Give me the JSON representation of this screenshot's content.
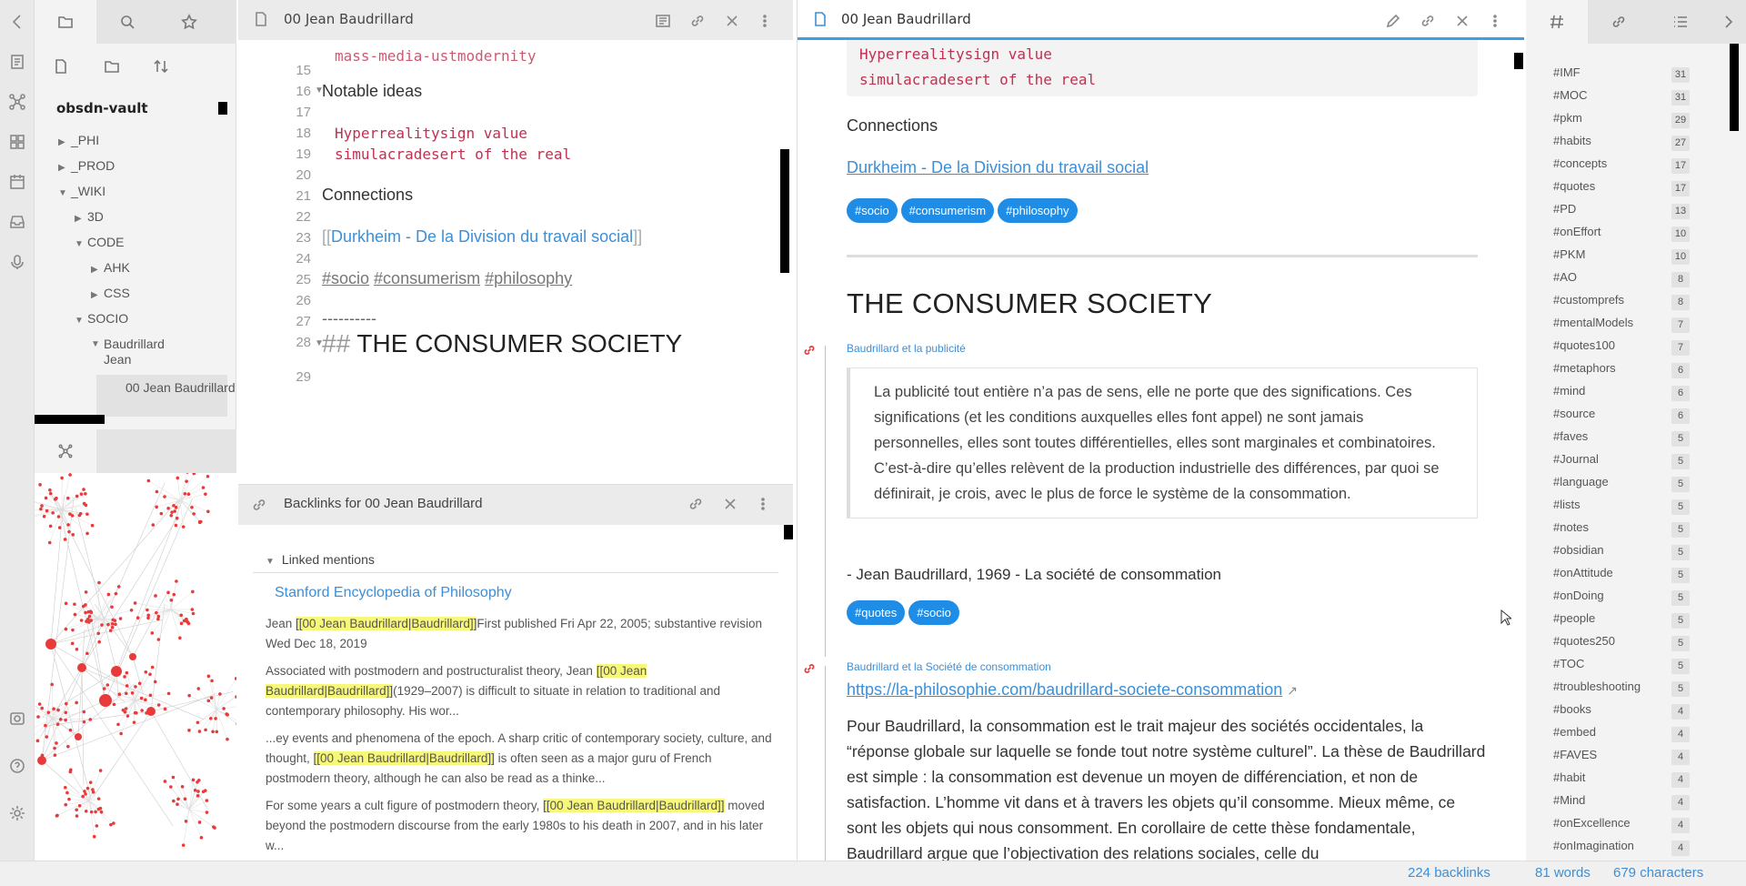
{
  "left_pane": {
    "vault_name": "obsdn-vault",
    "tree": [
      {
        "label": "_PHI",
        "level": 0,
        "state": "collapsed"
      },
      {
        "label": "_PROD",
        "level": 0,
        "state": "collapsed"
      },
      {
        "label": "_WIKI",
        "level": 0,
        "state": "expanded"
      },
      {
        "label": "3D",
        "level": 1,
        "state": "collapsed"
      },
      {
        "label": "CODE",
        "level": 1,
        "state": "expanded"
      },
      {
        "label": "AHK",
        "level": 2,
        "state": "collapsed"
      },
      {
        "label": "CSS",
        "level": 2,
        "state": "collapsed"
      },
      {
        "label": "SOCIO",
        "level": 1,
        "state": "expanded"
      },
      {
        "label": "Baudrillard Jean",
        "level": 2,
        "state": "expanded"
      }
    ],
    "selected_file": "00 Jean Baudrillard"
  },
  "editor_pane": {
    "title": "00 Jean Baudrillard",
    "partial_top_line": "mass-media-ustmodernity",
    "line_numbers": [
      "15",
      "16",
      "17",
      "18",
      "19",
      "20",
      "21",
      "22",
      "23",
      "24",
      "25",
      "26",
      "27",
      "28",
      "29"
    ],
    "notable_ideas": "Notable ideas",
    "code1": "Hyperrealitysign value",
    "code2": "simulacradesert of the real",
    "connections": "Connections",
    "link_open": "[[",
    "link_text": "Durkheim - De la Division du travail social",
    "link_close": "]]",
    "tags": [
      "#socio",
      "#consumerism",
      "#philosophy"
    ],
    "rule": "----------",
    "heading_marker": "## ",
    "heading_text": "THE CONSUMER SOCIETY"
  },
  "backlinks_pane": {
    "title": "Backlinks for 00 Jean Baudrillard",
    "linked_mentions": "Linked mentions",
    "source": "Stanford Encyclopedia of Philosophy",
    "snippets": [
      {
        "before": "Jean ",
        "highlight": "[[00 Jean Baudrillard|Baudrillard]]",
        "after": "First published Fri Apr 22, 2005; substantive revision Wed Dec 18, 2019"
      },
      {
        "before": "Associated with postmodern and postructuralist theory, Jean ",
        "highlight": "[[00 Jean Baudrillard|Baudrillard]]",
        "after": "(1929–2007) is difficult to situate in relation to traditional and contemporary philosophy. His wor..."
      },
      {
        "before": "...ey events and phenomena of the epoch. A sharp critic of contemporary society, culture, and thought, ",
        "highlight": "[[00 Jean Baudrillard|Baudrillard]]",
        "after": " is often seen as a major guru of French postmodern theory, although he can also be read as a thinke..."
      },
      {
        "before": "For some years a cult figure of postmodern theory, ",
        "highlight": "[[00 Jean Baudrillard|Baudrillard]]",
        "after": " moved beyond the postmodern discourse from the early 1980s to his death in 2007, and in his later w..."
      }
    ]
  },
  "reader_pane": {
    "title": "00 Jean Baudrillard",
    "code1": "Hyperrealitysign value",
    "code2": "simulacradesert of the real",
    "connections": "Connections",
    "link": "Durkheim - De la Division du travail social",
    "tags": [
      "#socio",
      "#consumerism",
      "#philosophy"
    ],
    "heading": "THE CONSUMER SOCIETY",
    "embed1_title": "Baudrillard et la publicité",
    "quote": "La publicité tout entière n’a pas de sens, elle ne porte que des significations. Ces significations (et les conditions auxquelles elles font appel) ne sont jamais personnelles, elles sont toutes différentielles, elles sont marginales et combinatoires. C’est-à-dire qu’elles relèvent de la production industrielle des différences, par quoi se définirait, je crois, avec le plus de force le système de la consommation.",
    "attribution": "- Jean Baudrillard, 1969 - La société de consommation",
    "tags2": [
      "#quotes",
      "#socio"
    ],
    "embed2_title": "Baudrillard et la Société de consommation",
    "url": "https://la-philosophie.com/baudrillard-societe-consommation",
    "paragraph": "Pour Baudrillard, la consommation est le trait majeur des sociétés occidentales, la “réponse globale sur laquelle se fonde tout notre système culturel”. La thèse de Baudrillard est simple : la consommation est devenue un moyen de différenciation, et non de satisfaction. L’homme vit dans et à travers les objets qu’il consomme. Mieux même, ce sont les objets qui nous consomment. En corollaire de cette thèse fondamentale, Baudrillard argue que l’objectivation des relations sociales, celle du"
  },
  "right_pane": {
    "tags": [
      {
        "name": "#IMF",
        "count": "31"
      },
      {
        "name": "#MOC",
        "count": "31"
      },
      {
        "name": "#pkm",
        "count": "29"
      },
      {
        "name": "#habits",
        "count": "27"
      },
      {
        "name": "#concepts",
        "count": "17"
      },
      {
        "name": "#quotes",
        "count": "17"
      },
      {
        "name": "#PD",
        "count": "13"
      },
      {
        "name": "#onEffort",
        "count": "10"
      },
      {
        "name": "#PKM",
        "count": "10"
      },
      {
        "name": "#AO",
        "count": "8"
      },
      {
        "name": "#customprefs",
        "count": "8"
      },
      {
        "name": "#mentalModels",
        "count": "7"
      },
      {
        "name": "#quotes100",
        "count": "7"
      },
      {
        "name": "#metaphors",
        "count": "6"
      },
      {
        "name": "#mind",
        "count": "6"
      },
      {
        "name": "#source",
        "count": "6"
      },
      {
        "name": "#faves",
        "count": "5"
      },
      {
        "name": "#Journal",
        "count": "5"
      },
      {
        "name": "#language",
        "count": "5"
      },
      {
        "name": "#lists",
        "count": "5"
      },
      {
        "name": "#notes",
        "count": "5"
      },
      {
        "name": "#obsidian",
        "count": "5"
      },
      {
        "name": "#onAttitude",
        "count": "5"
      },
      {
        "name": "#onDoing",
        "count": "5"
      },
      {
        "name": "#people",
        "count": "5"
      },
      {
        "name": "#quotes250",
        "count": "5"
      },
      {
        "name": "#TOC",
        "count": "5"
      },
      {
        "name": "#troubleshooting",
        "count": "5"
      },
      {
        "name": "#books",
        "count": "4"
      },
      {
        "name": "#embed",
        "count": "4"
      },
      {
        "name": "#FAVES",
        "count": "4"
      },
      {
        "name": "#habit",
        "count": "4"
      },
      {
        "name": "#Mind",
        "count": "4"
      },
      {
        "name": "#onExcellence",
        "count": "4"
      },
      {
        "name": "#onImagination",
        "count": "4"
      }
    ]
  },
  "status_bar": {
    "backlinks": "224 backlinks",
    "words": "81 words",
    "characters": "679 characters"
  },
  "colors": {
    "accent": "#1f8ce6",
    "code": "#c03050",
    "highlight": "#f7f77a",
    "graph_node": "#e83a3a"
  }
}
